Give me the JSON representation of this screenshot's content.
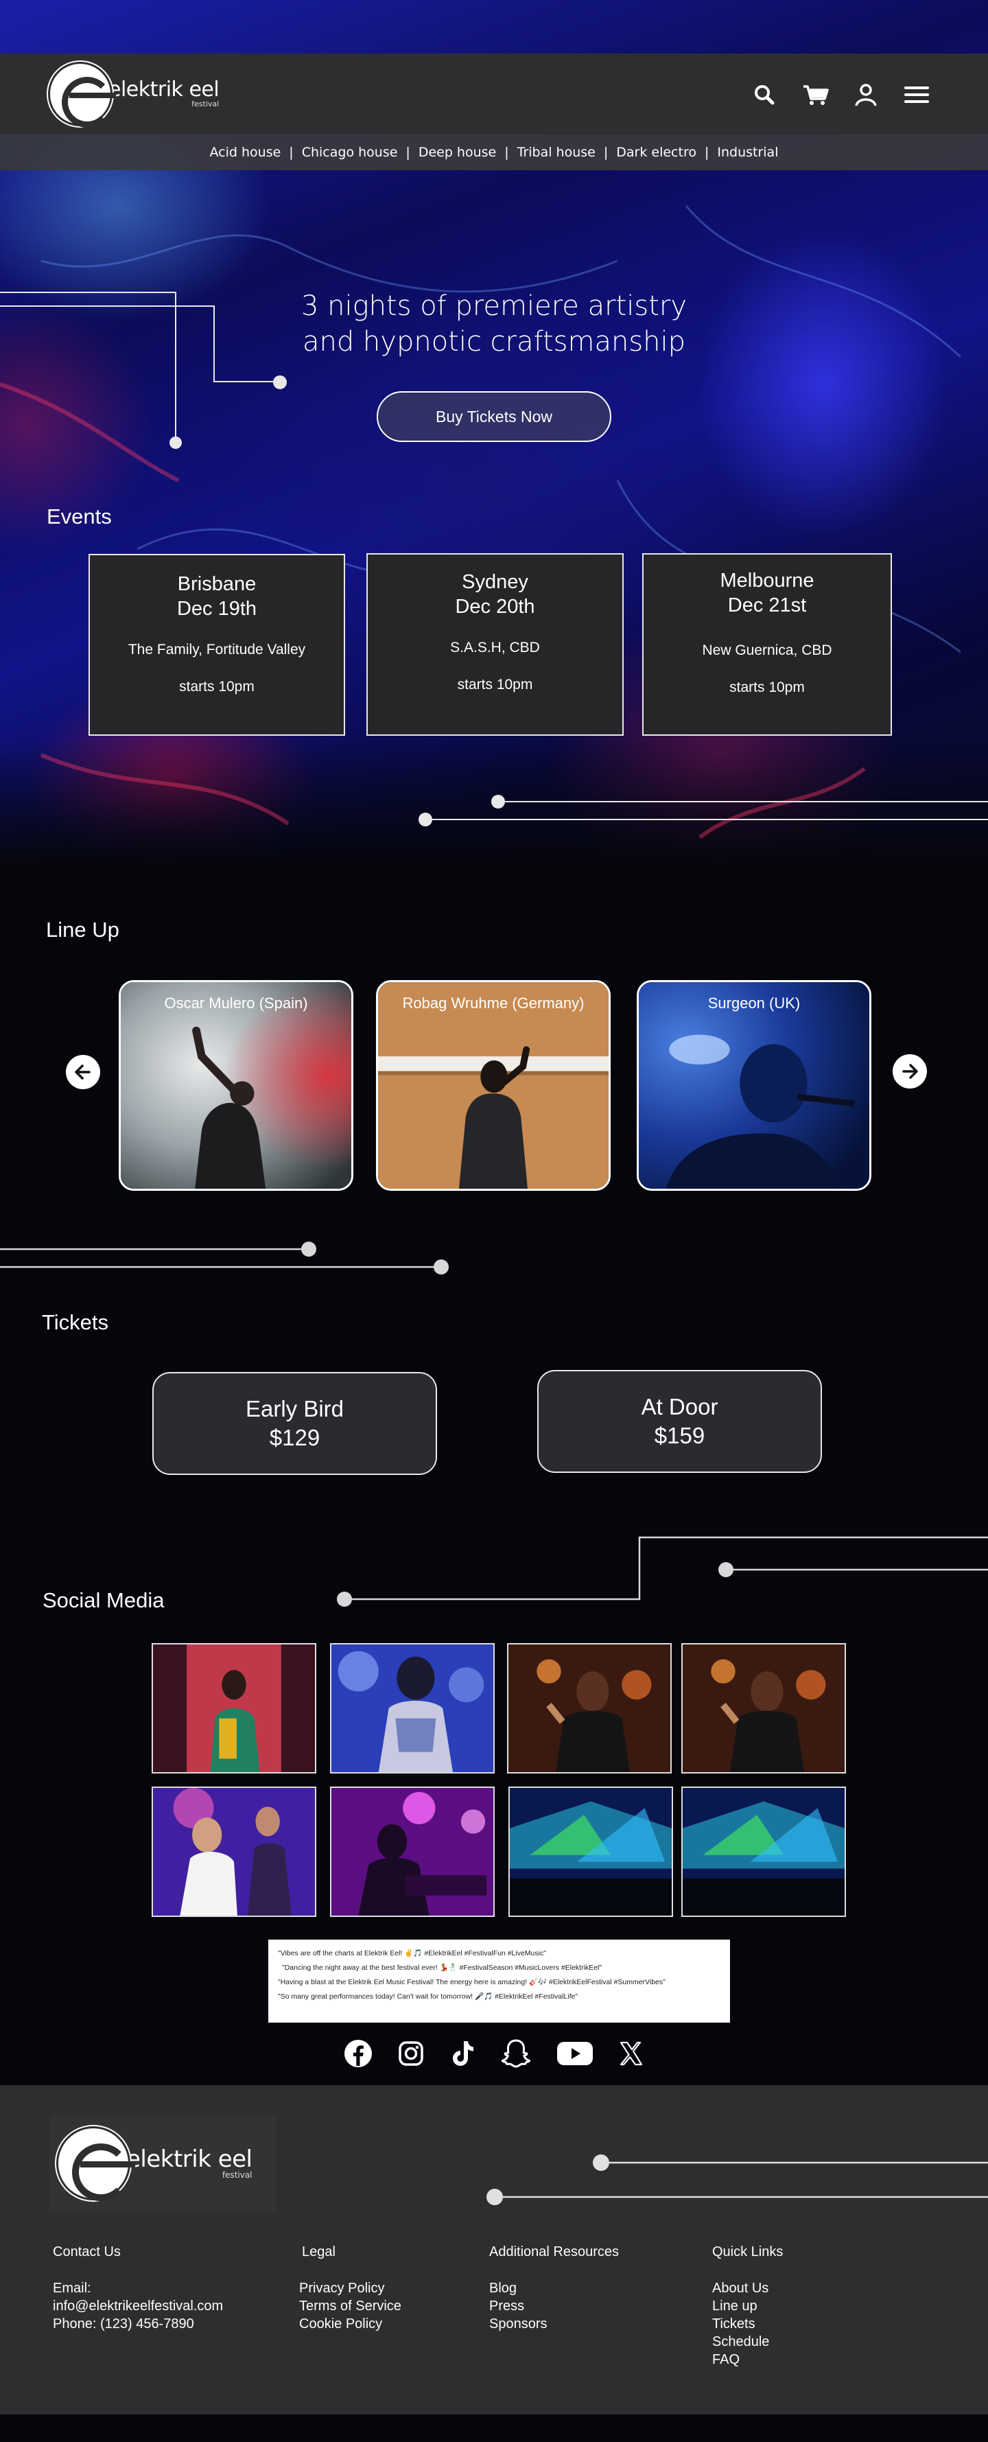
{
  "brand": {
    "name": "elektrik eel",
    "sub": "festival"
  },
  "header": {
    "icons": [
      "search-icon",
      "cart-icon",
      "user-icon",
      "menu-icon"
    ],
    "genres": [
      "Acid house",
      "Chicago house",
      "Deep house",
      "Tribal house",
      "Dark electro",
      "Industrial"
    ]
  },
  "hero": {
    "tagline_line1": "3 nights of premiere artistry",
    "tagline_line2": "and hypnotic craftsmanship",
    "cta": "Buy Tickets Now"
  },
  "events": {
    "heading": "Events",
    "items": [
      {
        "city": "Brisbane",
        "date": "Dec 19th",
        "venue": "The Family, Fortitude Valley",
        "time": "starts 10pm"
      },
      {
        "city": "Sydney",
        "date": "Dec 20th",
        "venue": "S.A.S.H, CBD",
        "time": "starts 10pm"
      },
      {
        "city": "Melbourne",
        "date": "Dec 21st",
        "venue": "New Guernica, CBD",
        "time": "starts 10pm"
      }
    ]
  },
  "lineup": {
    "heading": "Line Up",
    "artists": [
      {
        "name": "Oscar Mulero (Spain)"
      },
      {
        "name": "Robag Wruhme (Germany)"
      },
      {
        "name": "Surgeon (UK)"
      }
    ]
  },
  "tickets": {
    "heading": "Tickets",
    "items": [
      {
        "name": "Early Bird",
        "price": "$129"
      },
      {
        "name": "At Door",
        "price": "$159"
      }
    ]
  },
  "social": {
    "heading": "Social Media",
    "posts": [
      "\"Vibes are off the charts at Elektrik Eel! ✌️🎵 #ElektrikEel #FestivalFun #LiveMusic\"",
      "\"Dancing the night away at the best festival ever! 💃🕺 #FestivalSeason #MusicLovers #ElektrikEel\"",
      "\"Having a blast at the Elektrik Eel Music Festival! The energy here is amazing! 🎸🎶 #ElektrikEelFestival #SummerVibes\"",
      "\"So many great performances today! Can't wait for tomorrow! 🎤🎵 #ElektrikEel #FestivalLife\""
    ],
    "platforms": [
      "facebook-icon",
      "instagram-icon",
      "tiktok-icon",
      "snapchat-icon",
      "youtube-icon",
      "x-icon"
    ]
  },
  "footer": {
    "columns": [
      {
        "heading": "Contact Us",
        "items": [
          "Email:",
          "info@elektrikeelfestival.com",
          "Phone: (123) 456-7890"
        ]
      },
      {
        "heading": "Legal",
        "items": [
          "Privacy Policy",
          "Terms of Service",
          "Cookie Policy"
        ]
      },
      {
        "heading": "Additional Resources",
        "items": [
          "Blog",
          "Press",
          "Sponsors"
        ]
      },
      {
        "heading": "Quick Links",
        "items": [
          "About Us",
          "Line up",
          "Tickets",
          "Schedule",
          "FAQ"
        ]
      }
    ]
  }
}
